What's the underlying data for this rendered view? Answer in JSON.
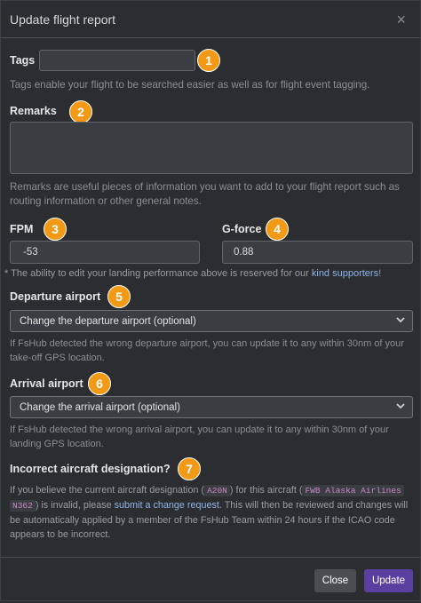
{
  "header": {
    "title": "Update flight report",
    "close_glyph": "×"
  },
  "tags": {
    "label": "Tags",
    "value": "",
    "help": "Tags enable your flight to be searched easier as well as for flight event tagging.",
    "badge": "1"
  },
  "remarks": {
    "label": "Remarks",
    "value": "",
    "help": "Remarks are useful pieces of information you want to add to your flight report such as routing information or other general notes.",
    "badge": "2"
  },
  "fpm": {
    "label": "FPM",
    "value": "-53",
    "badge": "3"
  },
  "gforce": {
    "label": "G-force",
    "value": "0.88",
    "badge": "4"
  },
  "kind_note": {
    "prefix": "* The ability to edit your landing performance above is reserved for our ",
    "link": "kind supporters",
    "suffix": "!"
  },
  "departure": {
    "label": "Departure airport",
    "badge": "5",
    "selected": "Change the departure airport (optional)",
    "help": "If FsHub detected the wrong departure airport, you can update it to any within 30nm of your take-off GPS location."
  },
  "arrival": {
    "label": "Arrival airport",
    "badge": "6",
    "selected": "Change the arrival airport (optional)",
    "help": "If FsHub detected the wrong arrival airport, you can update it to any within 30nm of your landing GPS location."
  },
  "aircraft": {
    "label": "Incorrect aircraft designation?",
    "badge": "7",
    "t1": "If you believe the current aircraft designation (",
    "code1": "A20N",
    "t2": ") for this aircraft (",
    "code2a": "FWB Alaska Airlines",
    "code2b": "N362",
    "t3": ") is invalid, please ",
    "link": "submit a change request",
    "t4": ". This will then be reviewed and changes will be automatically applied by a member of the FsHub Team within 24 hours if the ICAO code appears to be incorrect."
  },
  "footer": {
    "close_label": "Close",
    "update_label": "Update"
  },
  "colors": {
    "badge": "#f29a16",
    "link": "#8fb4e8",
    "update_button": "#5b3fa0",
    "close_button": "#4a4d52"
  },
  "icons": {
    "select_arrow": "chevron-down-icon"
  }
}
